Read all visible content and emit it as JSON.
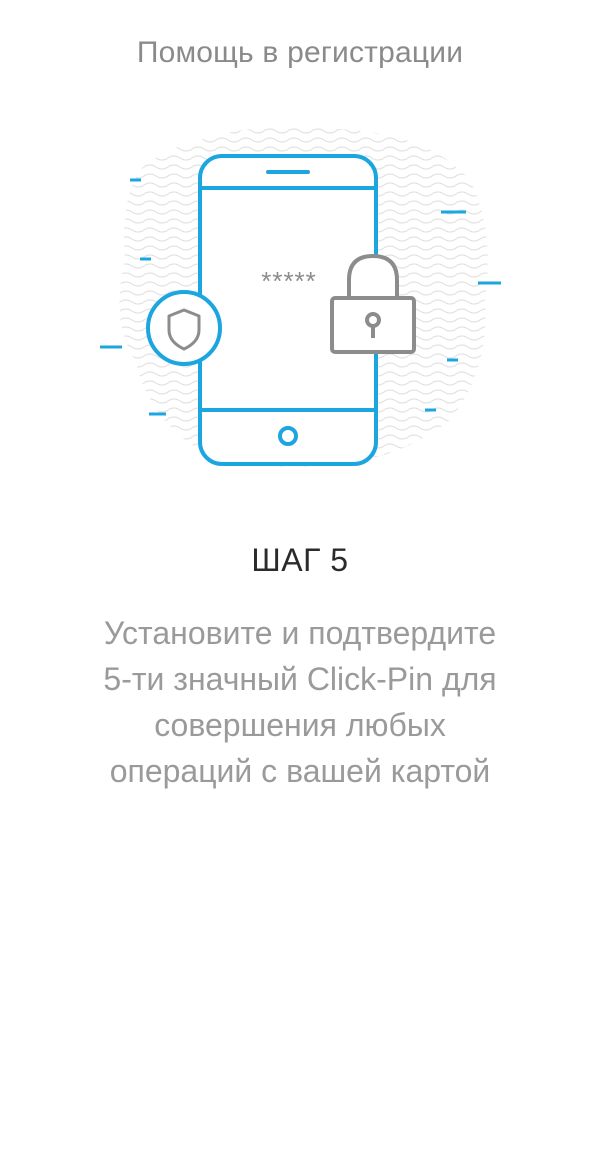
{
  "header": {
    "title": "Помощь в регистрации"
  },
  "illustration": {
    "pin_mask": "*****",
    "icons": [
      "phone-icon",
      "shield-icon",
      "lock-icon"
    ],
    "colors": {
      "accent": "#1ba6e0",
      "gray": "#8c8c8c",
      "wave": "#e6e6e6"
    }
  },
  "step": {
    "title": "ШАГ 5",
    "description": "Установите и подтвердите\n5-ти значный Click-Pin для\nсовершения любых\nопераций  с вашей картой"
  }
}
